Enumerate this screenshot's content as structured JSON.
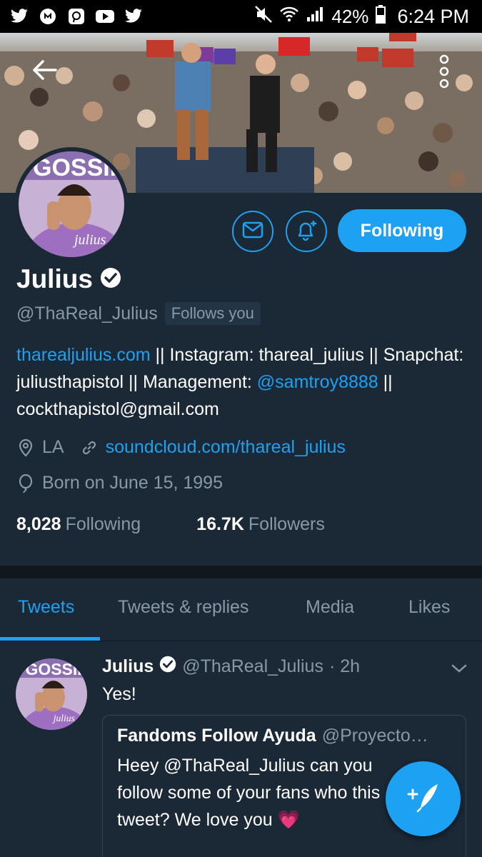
{
  "status_bar": {
    "left_icons": [
      "twitter-icon",
      "musically-icon",
      "periscope-icon",
      "youtube-icon",
      "twitter-icon"
    ],
    "battery": "42%",
    "time": "6:24 PM"
  },
  "profile": {
    "name": "Julius",
    "verified": true,
    "handle": "@ThaReal_Julius",
    "follows_you": "Follows you",
    "bio": {
      "link1": "tharealjulius.com",
      "text1": " || Instagram: thareal_julius || Snapchat: juliusthapistol || Management: ",
      "link2": "@samtroy8888",
      "text2": " || cockthapistol@gmail.com"
    },
    "location": "LA",
    "website": "soundcloud.com/thareal_julius",
    "birthday": "Born on June 15, 1995",
    "following_count": "8,028",
    "following_label": "Following",
    "followers_count": "16.7K",
    "followers_label": "Followers"
  },
  "actions": {
    "follow_label": "Following"
  },
  "tabs": [
    {
      "label": "Tweets",
      "active": true
    },
    {
      "label": "Tweets & replies",
      "active": false
    },
    {
      "label": "Media",
      "active": false
    },
    {
      "label": "Likes",
      "active": false
    }
  ],
  "tweet": {
    "name": "Julius",
    "handle": "@ThaReal_Julius",
    "time": "· 2h",
    "text": "Yes!",
    "quote": {
      "name": "Fandoms Follow Ayuda",
      "handle": "@Proyecto…",
      "text": "Heey @ThaReal_Julius can you follow some of your fans who this tweet? We love you 💗"
    }
  },
  "colors": {
    "accent": "#1da1f2",
    "background": "#1b2836",
    "muted": "#8899a6"
  }
}
